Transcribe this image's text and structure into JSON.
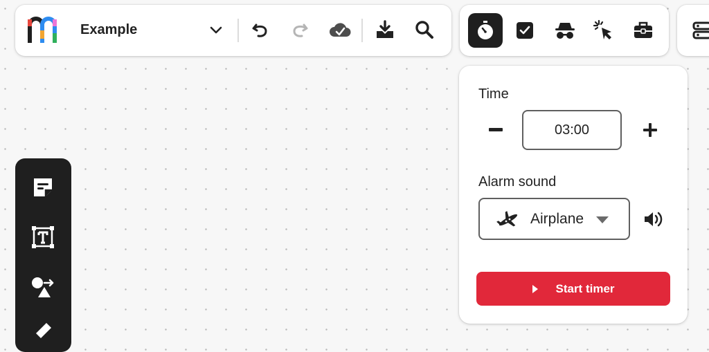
{
  "header": {
    "board_title": "Example",
    "icons": [
      "dropdown-chevron-icon",
      "undo-icon",
      "redo-icon",
      "cloud-saved-icon",
      "download-icon",
      "search-icon"
    ]
  },
  "tools": {
    "items": [
      "timer-icon",
      "checkbox-icon",
      "incognito-icon",
      "cursor-click-icon",
      "toolbox-icon"
    ],
    "active": "timer-icon"
  },
  "side_tools": [
    "sticky-note-icon",
    "text-icon",
    "shapes-icon",
    "pen-icon"
  ],
  "timer": {
    "time_label": "Time",
    "time_value": "03:00",
    "alarm_label": "Alarm sound",
    "alarm_value": "Airplane",
    "start_label": "Start timer"
  },
  "colors": {
    "accent_red": "#e1283a",
    "dark": "#1f1f1f",
    "logo": [
      "#f2a531",
      "#2e8cf0",
      "#2fb05c",
      "#e8473e",
      "#ec77d7"
    ]
  }
}
